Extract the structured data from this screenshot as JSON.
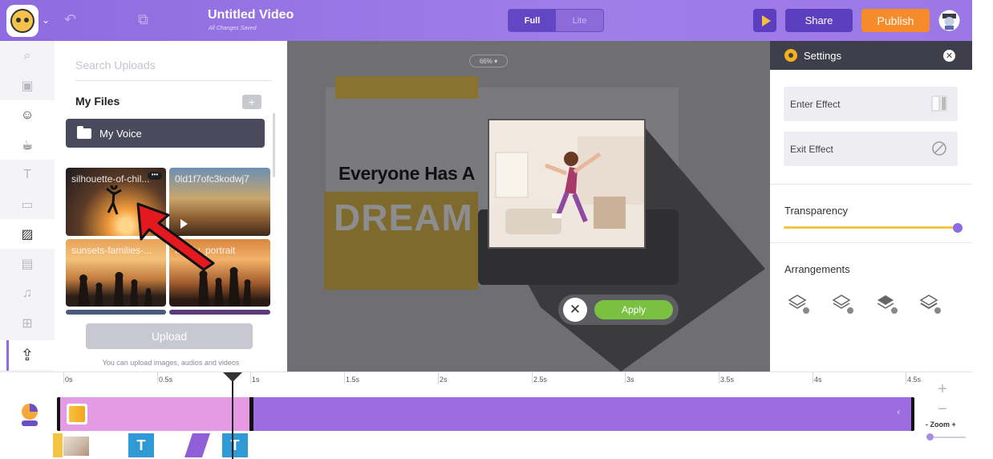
{
  "header": {
    "title": "Untitled Video",
    "subtitle": "All Changes Saved",
    "mode_full": "Full",
    "mode_lite": "Lite",
    "share": "Share",
    "publish": "Publish"
  },
  "uploads": {
    "search_placeholder": "Search Uploads",
    "my_files": "My Files",
    "folder": "My Voice",
    "thumbs": [
      {
        "label": "silhouette-of-chil..."
      },
      {
        "label": "0ld1f7ofc3kodwj7"
      },
      {
        "label": "sunsets-families-..."
      },
      {
        "label": "family_portrait"
      }
    ],
    "upload_button": "Upload",
    "upload_hint": "You can upload images, audios and videos"
  },
  "canvas": {
    "zoom": "66%",
    "headline": "Everyone Has A",
    "big_word": "DREAM",
    "apply": "Apply"
  },
  "settings": {
    "title": "Settings",
    "enter_effect": "Enter Effect",
    "exit_effect": "Exit Effect",
    "transparency": "Transparency",
    "transparency_value": 1.0,
    "arrangements": "Arrangements"
  },
  "timeline": {
    "ticks": [
      "0s",
      "0.5s",
      "1s",
      "1.5s",
      "2s",
      "2.5s",
      "3s",
      "3.5s",
      "4s",
      "4.5s"
    ],
    "zoom_label": "- Zoom +",
    "text_chip": "T"
  },
  "colors": {
    "brand_purple": "#8e6be0",
    "publish_orange": "#f58b2a",
    "apply_green": "#7ac142",
    "track_purple": "#9c6de0",
    "track_pink": "#e59ae6"
  }
}
